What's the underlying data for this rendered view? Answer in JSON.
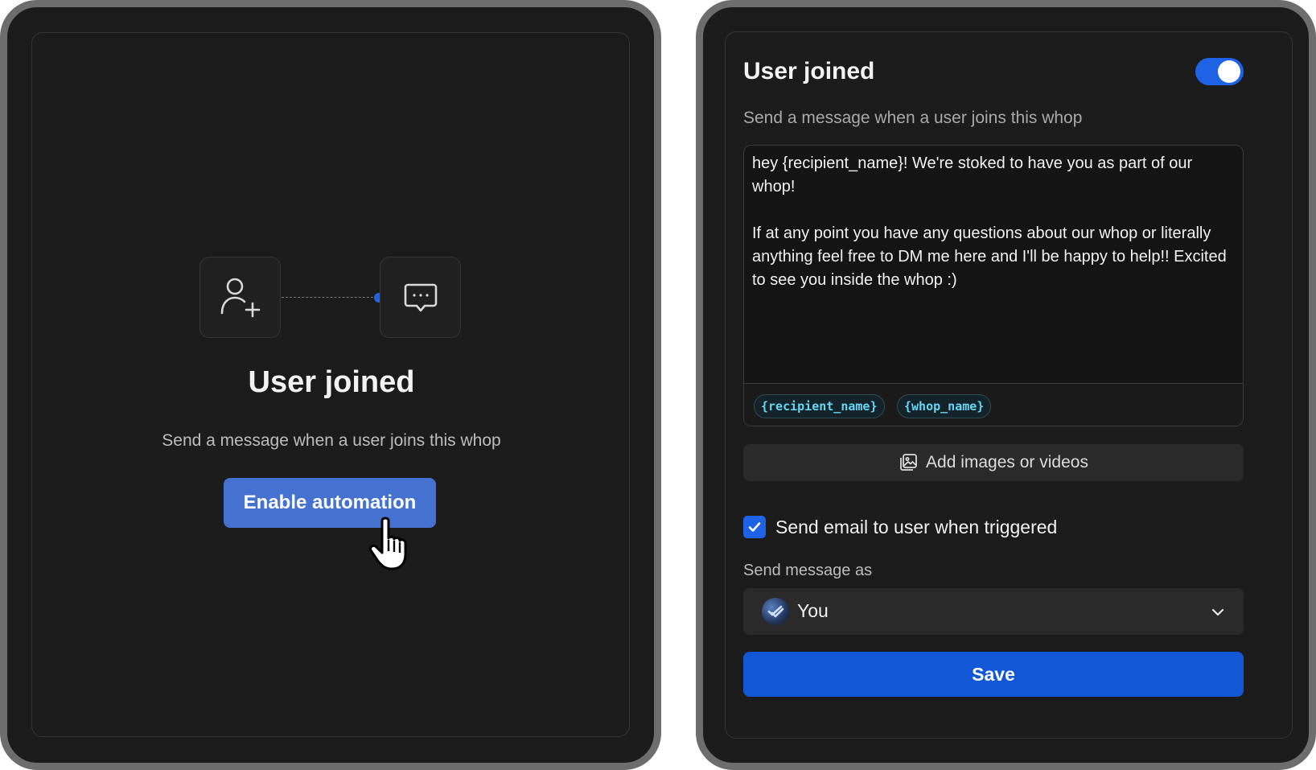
{
  "left_panel": {
    "title": "User joined",
    "subtitle": "Send a message when a user joins this whop",
    "enable_label": "Enable automation",
    "trigger_icon": "user-add-icon",
    "action_icon": "chat-bubble-icon"
  },
  "right_panel": {
    "title": "User joined",
    "subtitle": "Send a message when a user joins this whop",
    "toggle_on": true,
    "message": "hey {recipient_name}! We're stoked to have you as part of our whop!\n\nIf at any point you have any questions about our whop or literally anything feel free to DM me here and I'll be happy to help!! Excited to see you inside the whop :)",
    "variables": [
      "{recipient_name}",
      "{whop_name}"
    ],
    "media_label": "Add images or videos",
    "email_checkbox_label": "Send email to user when triggered",
    "email_checked": true,
    "send_as_label": "Send message as",
    "sender": "You",
    "save_label": "Save"
  },
  "colors": {
    "accent": "#1e63e6",
    "enable_button": "#4572d0",
    "save_button": "#1258d6",
    "variable_text": "#67d6f3",
    "background": "#1b1b1b"
  }
}
